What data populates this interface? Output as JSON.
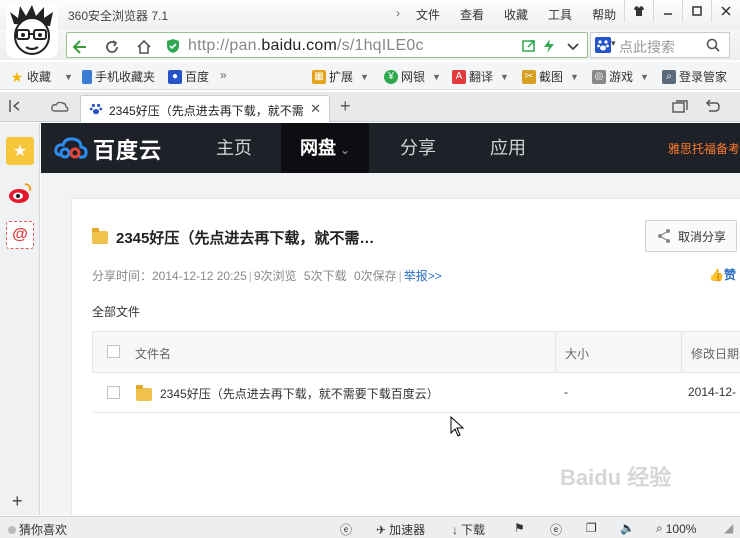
{
  "browser": {
    "title": "360安全浏览器 7.1",
    "menu": [
      "文件",
      "查看",
      "收藏",
      "工具",
      "帮助"
    ],
    "window_controls": [
      "shirt-icon",
      "minimize-icon",
      "maximize-icon",
      "close-icon"
    ]
  },
  "address_bar": {
    "url_prefix": "http://pan.",
    "url_domain": "baidu.com",
    "url_path": "/s/1hqILE0c",
    "search_placeholder": "点此搜索"
  },
  "favorites": {
    "items": [
      {
        "label": "收藏",
        "icon": "star-add-icon"
      },
      {
        "label": "手机收藏夹",
        "icon": "phone-icon"
      },
      {
        "label": "百度",
        "icon": "baidu-paw-icon"
      }
    ],
    "more": "»",
    "tools": [
      {
        "label": "扩展",
        "icon": "extension-icon"
      },
      {
        "label": "网银",
        "icon": "bank-icon"
      },
      {
        "label": "翻译",
        "icon": "translate-icon"
      },
      {
        "label": "截图",
        "icon": "screenshot-icon"
      },
      {
        "label": "游戏",
        "icon": "game-icon"
      },
      {
        "label": "登录管家",
        "icon": "login-icon"
      }
    ]
  },
  "tabs": [
    {
      "title": "2345好压（先点进去再下载，就不需",
      "active": true
    }
  ],
  "baidu_nav": {
    "logo_text": "百度云",
    "items": [
      {
        "label": "主页",
        "active": false
      },
      {
        "label": "网盘",
        "active": true
      },
      {
        "label": "分享",
        "active": false
      },
      {
        "label": "应用",
        "active": false
      }
    ],
    "promo": "雅思托福备考"
  },
  "share": {
    "title": "2345好压（先点进去再下载，就不需…",
    "unshare_label": "取消分享",
    "meta": {
      "time": "分享时间：2014-12-12 20:25",
      "views": "9次浏览",
      "downloads": "5次下载",
      "saves": "0次保存",
      "report": "举报>>"
    },
    "like": "赞",
    "breadcrumb": "全部文件",
    "columns": [
      "文件名",
      "大小",
      "修改日期"
    ],
    "rows": [
      {
        "name": "2345好压（先点进去再下载，就不需要下载百度云）",
        "size": "-",
        "date": "2014-12-"
      }
    ]
  },
  "statusbar": {
    "left": "猜你喜欢",
    "accelerator": "加速器",
    "download": "下载",
    "zoom": "100%"
  },
  "watermark": "Baidu 经验",
  "colors": {
    "address_border": "#9bc18c",
    "baidu_nav_bg": "#1e2127",
    "promo": "#ff7a2a",
    "link": "#2c6fc4"
  }
}
